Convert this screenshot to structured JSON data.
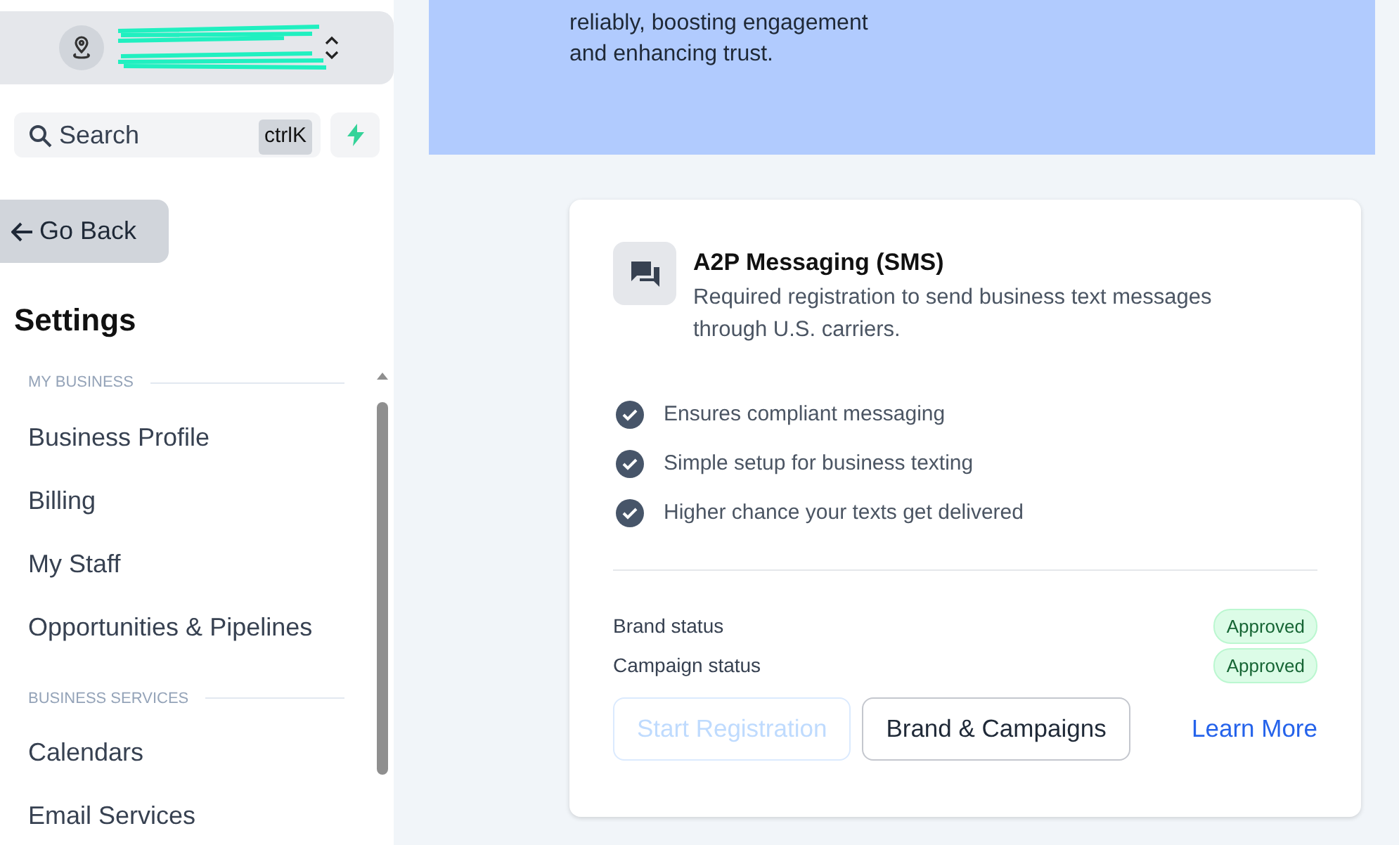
{
  "sidebar": {
    "search": {
      "placeholder": "Search",
      "shortcut": "ctrlK"
    },
    "back_button": "Go Back",
    "title": "Settings",
    "sections": [
      {
        "heading": "MY BUSINESS",
        "items": [
          {
            "label": "Business Profile"
          },
          {
            "label": "Billing"
          },
          {
            "label": "My Staff"
          },
          {
            "label": "Opportunities & Pipelines"
          }
        ]
      },
      {
        "heading": "BUSINESS SERVICES",
        "items": [
          {
            "label": "Calendars"
          },
          {
            "label": "Email Services"
          }
        ]
      }
    ]
  },
  "banner": {
    "lines": [
      "reliably, boosting engagement",
      "and enhancing trust."
    ]
  },
  "card": {
    "title": "A2P Messaging (SMS)",
    "description": "Required registration to send business text messages through U.S. carriers.",
    "benefits": [
      "Ensures compliant messaging",
      "Simple setup for business texting",
      "Higher chance your texts get delivered"
    ],
    "statuses": [
      {
        "label": "Brand status",
        "value": "Approved"
      },
      {
        "label": "Campaign status",
        "value": "Approved"
      }
    ],
    "buttons": [
      {
        "label": "Start Registration",
        "kind": "outline",
        "disabled": true
      },
      {
        "label": "Brand & Campaigns",
        "kind": "outline",
        "disabled": false
      },
      {
        "label": "Learn More",
        "kind": "link"
      }
    ]
  }
}
